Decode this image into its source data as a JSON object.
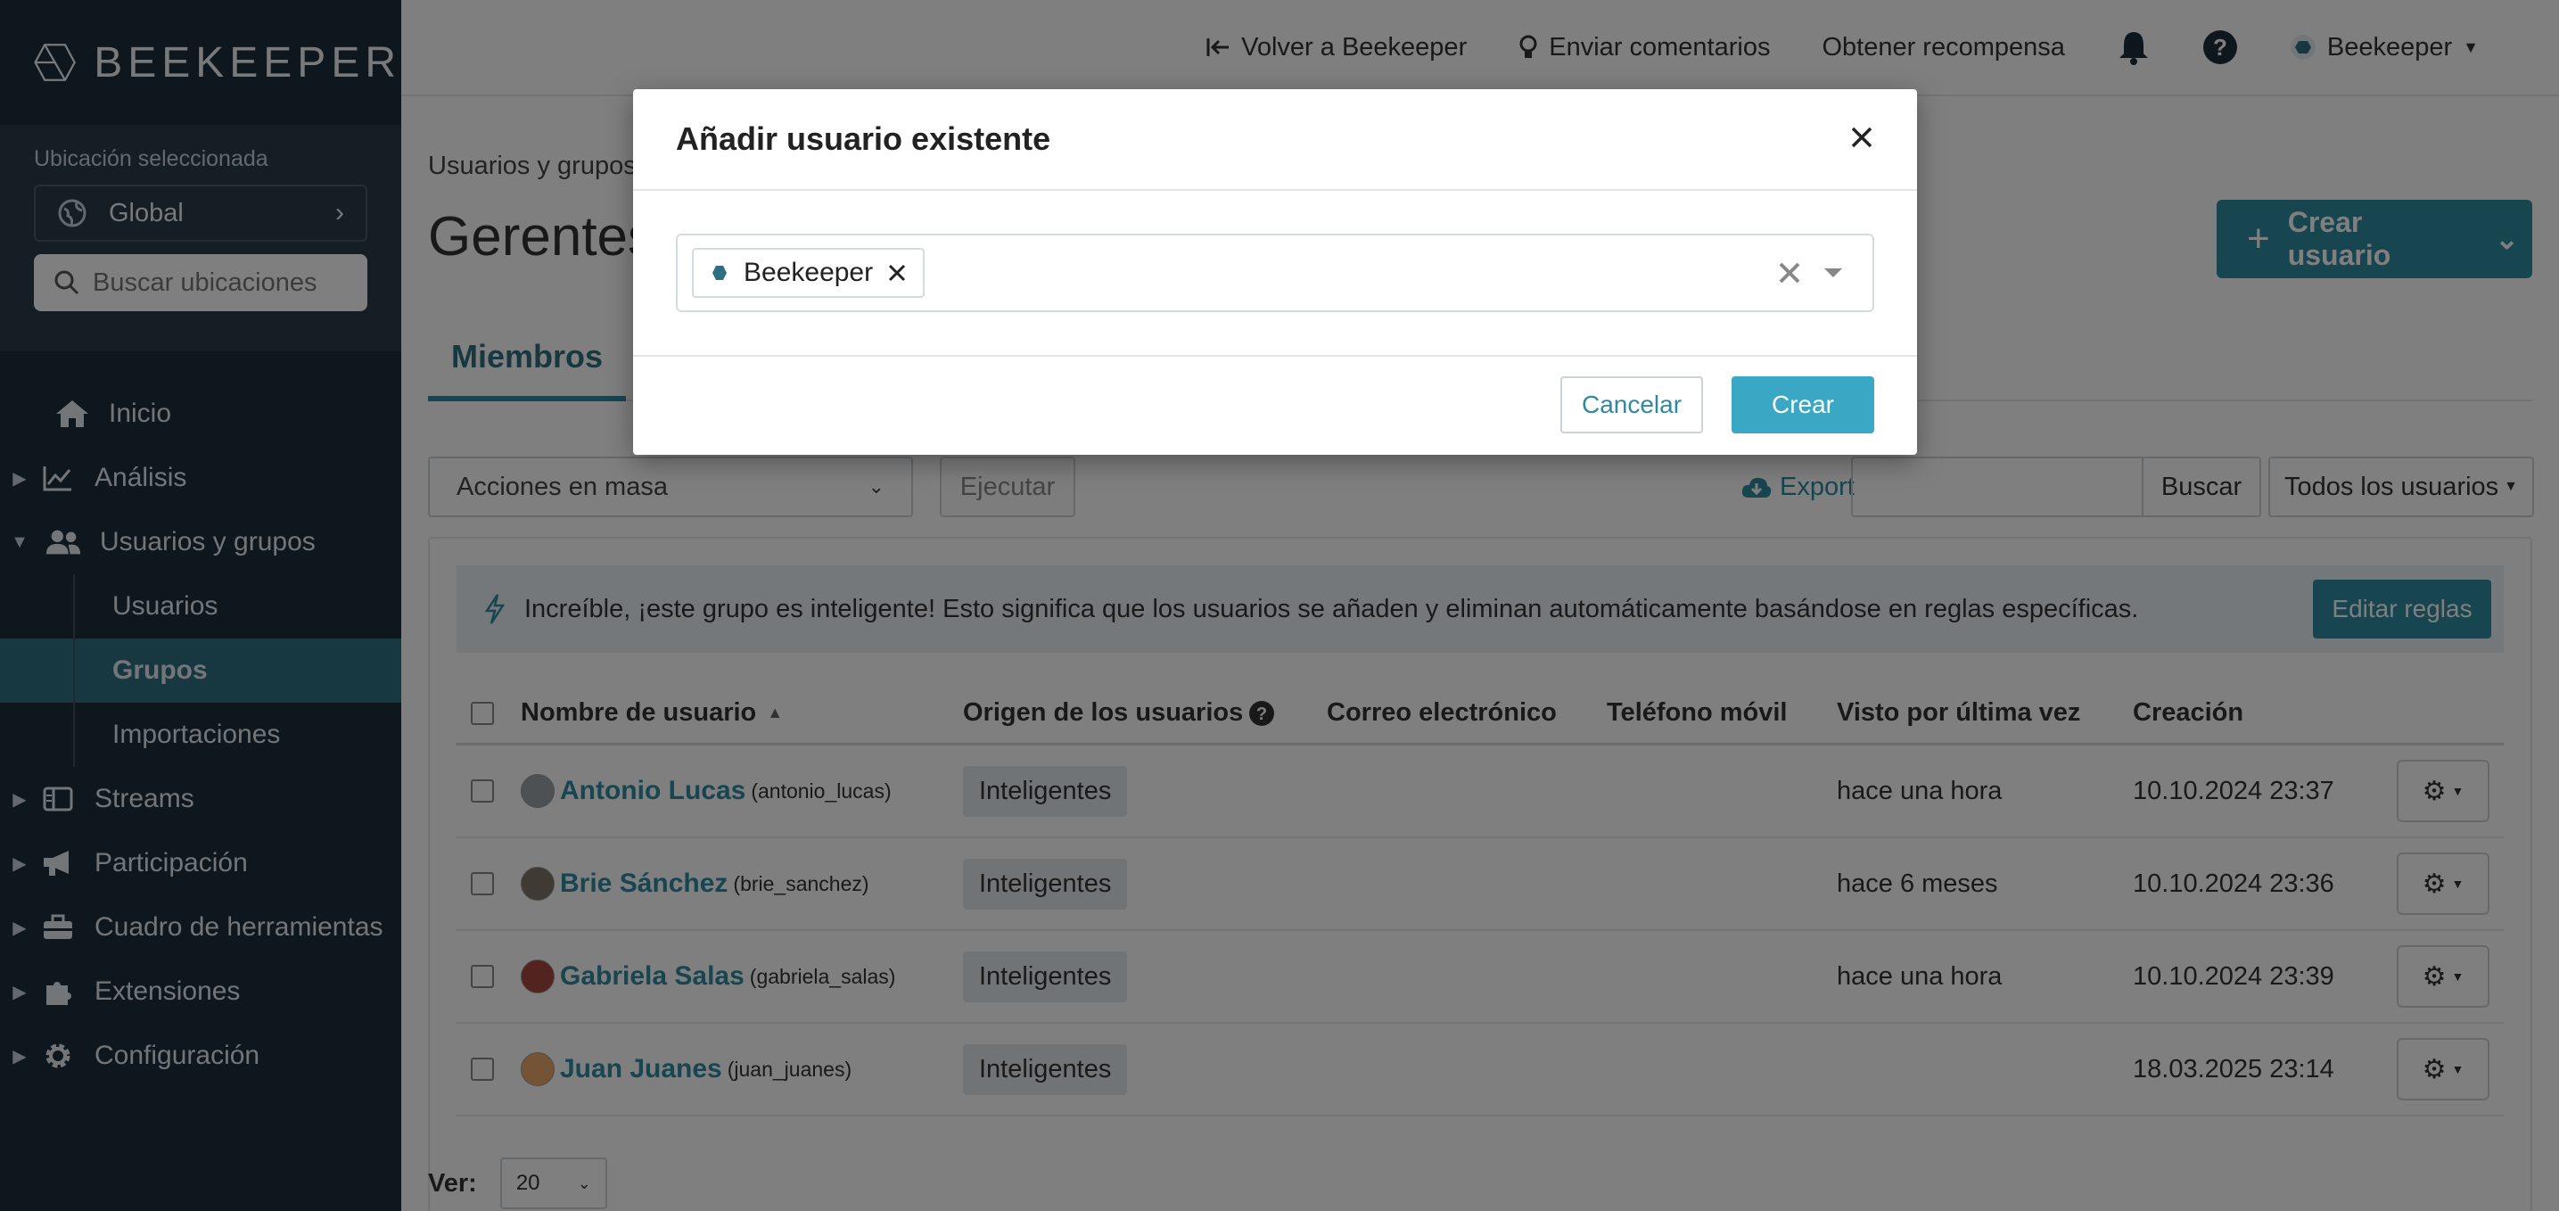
{
  "brand": {
    "name": "BEEKEEPER"
  },
  "sidebar": {
    "location_label": "Ubicación seleccionada",
    "location_value": "Global",
    "search_placeholder": "Buscar ubicaciones",
    "items": [
      {
        "label": "Inicio",
        "icon": "home-icon"
      },
      {
        "label": "Análisis",
        "icon": "chart-icon"
      },
      {
        "label": "Usuarios y grupos",
        "icon": "users-icon"
      },
      {
        "label": "Streams",
        "icon": "streams-icon"
      },
      {
        "label": "Participación",
        "icon": "megaphone-icon"
      },
      {
        "label": "Cuadro de herramientas",
        "icon": "toolbox-icon"
      },
      {
        "label": "Extensiones",
        "icon": "puzzle-icon"
      },
      {
        "label": "Configuración",
        "icon": "gear-icon"
      }
    ],
    "subitems": [
      "Usuarios",
      "Grupos",
      "Importaciones"
    ]
  },
  "topbar": {
    "back": "Volver a Beekeeper",
    "feedback": "Enviar comentarios",
    "reward": "Obtener recompensa",
    "account": "Beekeeper"
  },
  "page": {
    "breadcrumb": "Usuarios y grupos",
    "title": "Gerentes",
    "create_user": "Crear usuario",
    "tab_members": "Miembros"
  },
  "toolbar": {
    "bulk_actions": "Acciones en masa",
    "execute": "Ejecutar",
    "export": "Export",
    "search": "Buscar",
    "filter": "Todos los usuarios"
  },
  "info": {
    "text": "Increíble, ¡este grupo es inteligente! Esto significa que los usuarios se añaden y eliminan automáticamente basándose en reglas específicas.",
    "edit_rules": "Editar reglas"
  },
  "table": {
    "headers": [
      "Nombre de usuario",
      "Origen de los usuarios",
      "Correo electrónico",
      "Teléfono móvil",
      "Visto por última vez",
      "Creación"
    ],
    "rows": [
      {
        "name": "Antonio Lucas",
        "handle": "(antonio_lucas)",
        "origin": "Inteligentes",
        "last_seen": "hace una hora",
        "created": "10.10.2024 23:37"
      },
      {
        "name": "Brie Sánchez",
        "handle": "(brie_sanchez)",
        "origin": "Inteligentes",
        "last_seen": "hace 6 meses",
        "created": "10.10.2024 23:36"
      },
      {
        "name": "Gabriela Salas",
        "handle": "(gabriela_salas)",
        "origin": "Inteligentes",
        "last_seen": "hace una hora",
        "created": "10.10.2024 23:39"
      },
      {
        "name": "Juan Juanes",
        "handle": "(juan_juanes)",
        "origin": "Inteligentes",
        "last_seen": "",
        "created": "18.03.2025 23:14"
      }
    ]
  },
  "pager": {
    "label": "Ver:",
    "value": "20"
  },
  "modal": {
    "title": "Añadir usuario existente",
    "tag": "Beekeeper",
    "cancel": "Cancelar",
    "create": "Crear"
  },
  "colors": {
    "primary": "#2f8aa1",
    "sidebar": "#1f2f3d",
    "active": "#2f6f82"
  }
}
